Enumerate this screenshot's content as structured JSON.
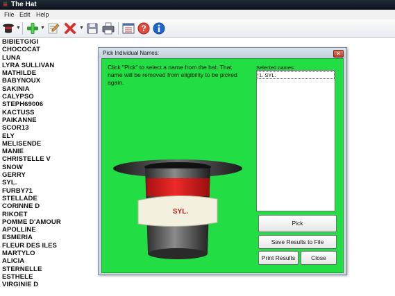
{
  "window": {
    "title": "The Hat"
  },
  "menu": {
    "items": [
      "File",
      "Edit",
      "Help"
    ]
  },
  "toolbar": {
    "icons": [
      "hat-icon",
      "add-icon",
      "edit-icon",
      "delete-icon",
      "save-icon",
      "print-icon",
      "checklist-icon",
      "help-icon",
      "info-icon"
    ]
  },
  "names": [
    "BIBIETGIGI",
    "CHOCOCAT",
    "LUNA",
    "LYRA SULLIVAN",
    "MATHILDE",
    "BABYNOUX",
    "SAKINIA",
    "CALYPSO",
    "STEPH69006",
    "KACTUSS",
    "PAIKANNE",
    "SCOR13",
    "ELY",
    "MELISENDE",
    "MANIE",
    "CHRISTELLE V",
    "SNOW",
    "GERRY",
    "SYL.",
    "FURBY71",
    "STELLADE",
    "CORINNE D",
    "RIKOET",
    "POMME D'AMOUR",
    "APOLLINE",
    "ESMERIA",
    "FLEUR DES ILES",
    "MARTYLO",
    "ALICIA",
    "STERNELLE",
    "ESTHELE",
    "VIRGINIE D"
  ],
  "dialog": {
    "title": "Pick Individual Names:",
    "close_symbol": "×",
    "instructions": "Click \"Pick\" to select a name from the hat. That name will be removed from eligibility to be picked again.",
    "selected_label": "Selected names:",
    "selected": [
      "1. SYL."
    ],
    "hat_band_text": "SYL.",
    "buttons": {
      "pick": "Pick",
      "save": "Save Results to File",
      "print": "Print Results",
      "close": "Close"
    }
  },
  "colors": {
    "dialog_bg": "#22dd44",
    "hat_band": "#dd1e1e",
    "accent_blue": "#1c67c9"
  }
}
